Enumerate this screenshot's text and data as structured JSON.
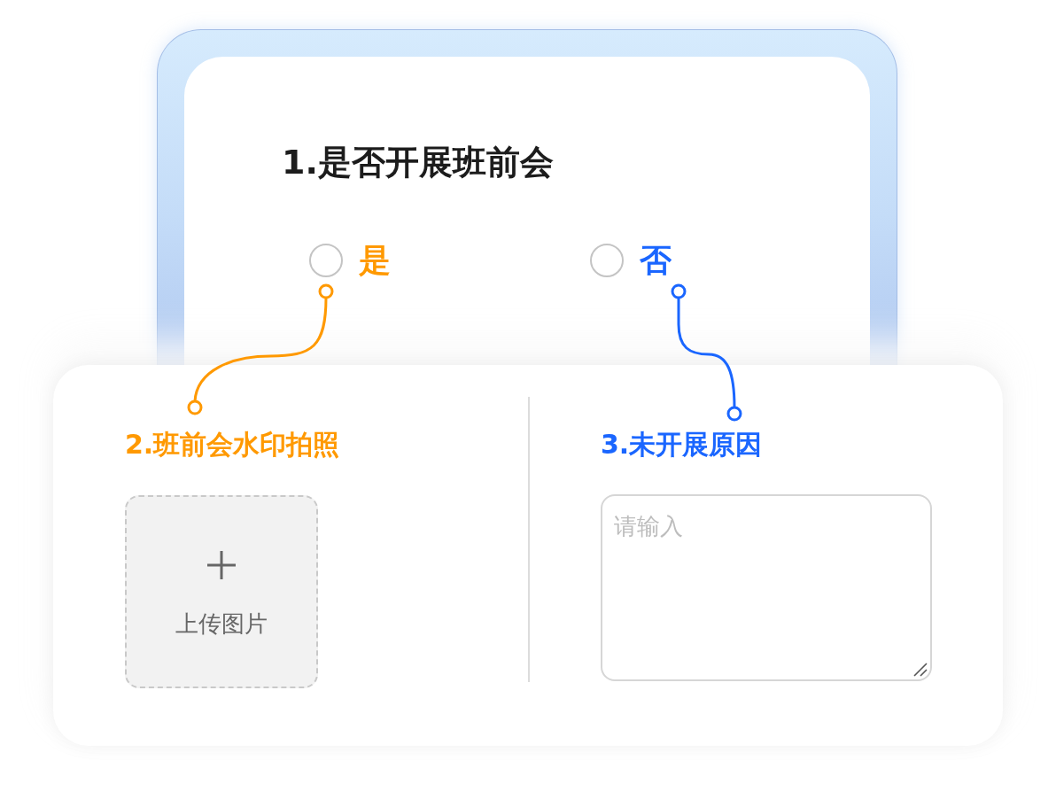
{
  "question": {
    "title": "1.是否开展班前会",
    "options": [
      {
        "label": "是",
        "selected": false,
        "color": "#ff9900",
        "follow_up": {
          "kind": "upload",
          "title": "2.班前会水印拍照",
          "button": "上传图片"
        }
      },
      {
        "label": "否",
        "selected": false,
        "color": "#1a66ff",
        "follow_up": {
          "kind": "text",
          "title": "3.未开展原因",
          "placeholder": "请输入"
        }
      }
    ]
  }
}
